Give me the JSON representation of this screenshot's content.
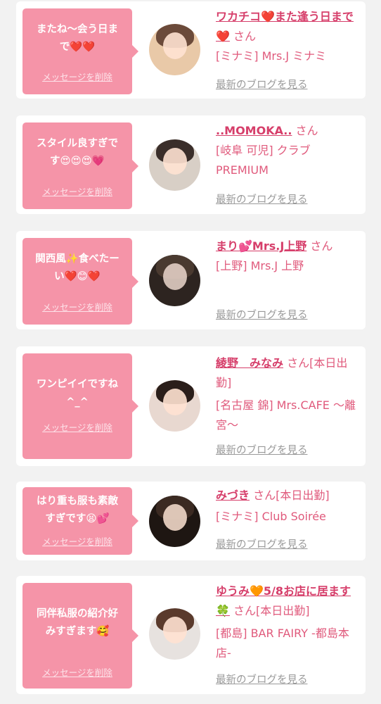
{
  "cards": [
    {
      "message": "またね〜会う日ま\nで❤️❤️",
      "delete_label": "メッセージを削除",
      "name": "ワカチコ❤️また逢う日まで❤️",
      "honorific": "さん",
      "shop": "[ミナミ] Mrs.J ミナミ",
      "blog_label": "最新のブログを見る",
      "avatar_colors": [
        "#e9c9a8",
        "#6b4a3a"
      ]
    },
    {
      "message": "スタイル良すぎで\nす😍😍😍💗",
      "delete_label": "メッセージを削除",
      "name": "..MOMOKA..",
      "honorific": "さん",
      "shop": "[岐阜 可児] クラブ PREMIUM",
      "blog_label": "最新のブログを見る",
      "avatar_colors": [
        "#d8cfc6",
        "#3a2e2a"
      ]
    },
    {
      "message": "関西風✨食べたー\nい❤️😊❤️",
      "delete_label": "メッセージを削除",
      "name": "まり💕Mrs.J上野",
      "honorific": "さん",
      "shop": "[上野] Mrs.J 上野",
      "blog_label": "最新のブログを見る",
      "avatar_colors": [
        "#2d2420",
        "#4a3a30"
      ]
    },
    {
      "message": "ワンピイイですね\n^_^",
      "delete_label": "メッセージを削除",
      "name": "綾野　みなみ",
      "honorific": "さん[本日出勤]",
      "shop": "[名古屋 錦] Mrs.CAFE 〜離宮〜",
      "blog_label": "最新のブログを見る",
      "avatar_colors": [
        "#e8d8d0",
        "#2a1e1a"
      ]
    },
    {
      "message": "はり重も服も素敵\nすぎです😫💕",
      "delete_label": "メッセージを削除",
      "name": "みづき",
      "honorific": "さん[本日出勤]",
      "shop": "[ミナミ] Club Soirée",
      "blog_label": "最新のブログを見る",
      "avatar_colors": [
        "#1e1612",
        "#3b2a22"
      ]
    },
    {
      "message": "同伴私服の紹介好\nみすぎます🥰",
      "delete_label": "メッセージを削除",
      "name": "ゆうみ🧡5/8お店に居ます🍀",
      "honorific": "さん[本日出勤]",
      "shop": "[都島] BAR FAIRY -都島本店-",
      "blog_label": "最新のブログを見る",
      "avatar_colors": [
        "#e7e2df",
        "#5a3a2c"
      ]
    }
  ],
  "colors": {
    "bubble": "#f594a8",
    "name": "#d63e6a",
    "link_gray": "#9a9a9a"
  }
}
